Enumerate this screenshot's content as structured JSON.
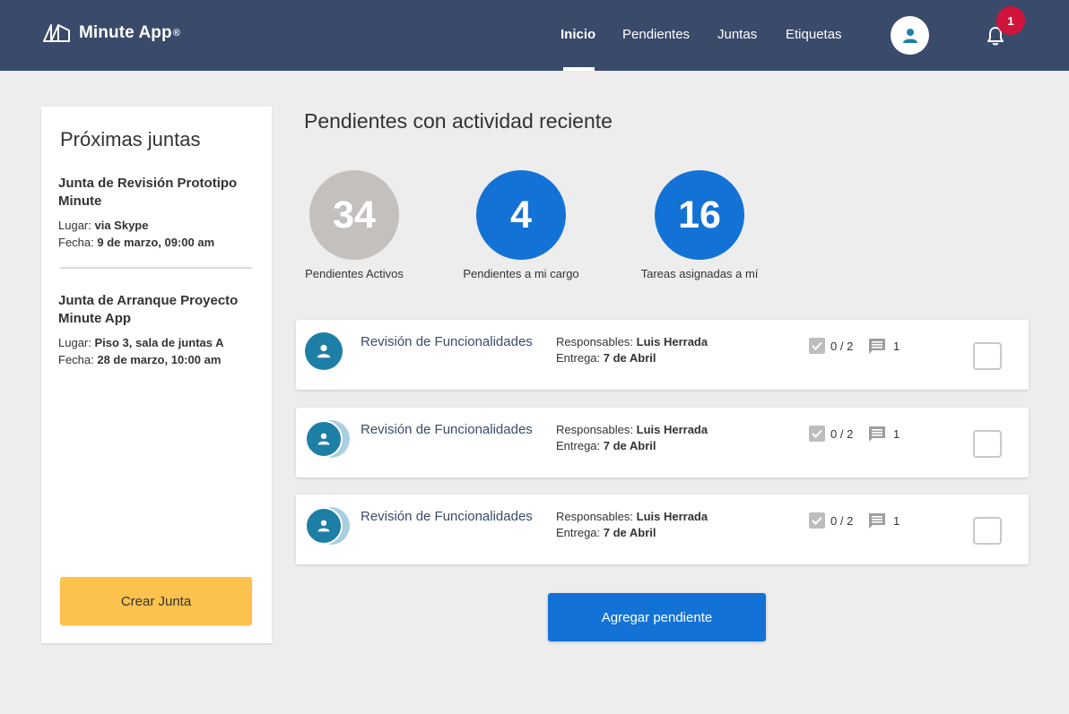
{
  "brand": {
    "name": "Minute App",
    "mark": "®"
  },
  "nav": {
    "items": [
      {
        "label": "Inicio",
        "active": true
      },
      {
        "label": "Pendientes",
        "active": false
      },
      {
        "label": "Juntas",
        "active": false
      },
      {
        "label": "Etiquetas",
        "active": false
      }
    ]
  },
  "notifications": {
    "count": "1",
    "icon": "bell-icon"
  },
  "user": {
    "icon": "user-icon"
  },
  "sidebar": {
    "title": "Próximas juntas",
    "meetings": [
      {
        "title": "Junta de Revisión Prototipo Minute",
        "place_label": "Lugar: ",
        "place": "via Skype",
        "date_label": "Fecha: ",
        "date": "9 de marzo, 09:00 am"
      },
      {
        "title": "Junta de Arranque Proyecto Minute App",
        "place_label": "Lugar: ",
        "place": "Piso 3, sala de juntas A",
        "date_label": "Fecha: ",
        "date": "28 de marzo, 10:00 am"
      }
    ],
    "create_button": "Crear Junta"
  },
  "main": {
    "title": "Pendientes con actividad reciente",
    "stats": [
      {
        "value": "34",
        "label": "Pendientes Activos",
        "color": "#c4c0bd"
      },
      {
        "value": "4",
        "label": "Pendientes a mi cargo",
        "color": "#1372d6"
      },
      {
        "value": "16",
        "label": "Tareas asignadas a mí",
        "color": "#1372d6"
      }
    ],
    "tasks": [
      {
        "name": "Revisión de Funcionalidades",
        "resp_label": "Responsables: ",
        "resp": "Luis Herrada",
        "due_label": "Entrega: ",
        "due": "7 de Abril",
        "checklist": "0 / 2",
        "comments": "1",
        "multiple_avatars": false
      },
      {
        "name": "Revisión de Funcionalidades",
        "resp_label": "Responsables: ",
        "resp": "Luis Herrada",
        "due_label": "Entrega: ",
        "due": "7 de Abril",
        "checklist": "0 / 2",
        "comments": "1",
        "multiple_avatars": true
      },
      {
        "name": "Revisión de Funcionalidades",
        "resp_label": "Responsables: ",
        "resp": "Luis Herrada",
        "due_label": "Entrega: ",
        "due": "7 de Abril",
        "checklist": "0 / 2",
        "comments": "1",
        "multiple_avatars": true
      }
    ],
    "add_button": "Agregar pendiente"
  },
  "colors": {
    "header": "#3a4a6b",
    "accent": "#1372d6",
    "create_button": "#fcc24d",
    "badge": "#d0143c",
    "avatar": "#1e7fa6"
  }
}
